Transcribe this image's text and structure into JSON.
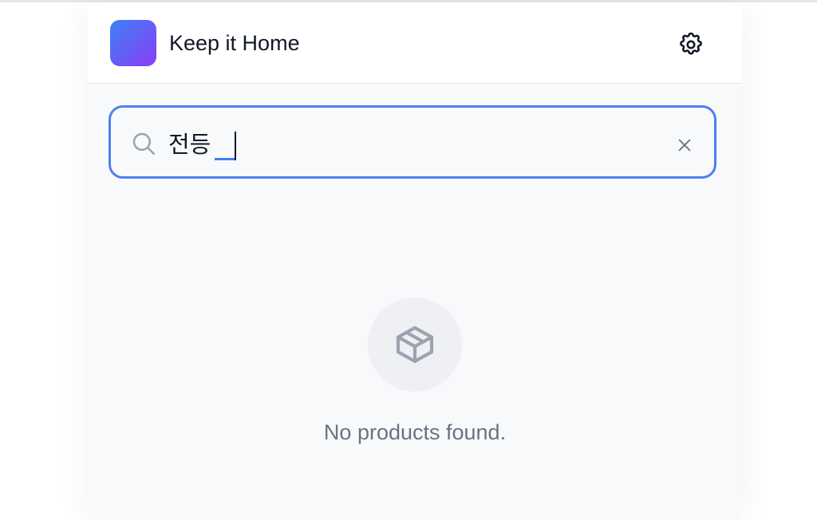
{
  "app": {
    "title": "Keep it Home",
    "brand_gradient": [
      "#3b82f6",
      "#8b3cf6"
    ]
  },
  "header": {
    "settings_icon": "gear-icon"
  },
  "search": {
    "value": "전등",
    "placeholder": "",
    "search_icon": "search-icon",
    "clear_icon": "close-icon",
    "focus_color": "#4f7ff0"
  },
  "empty_state": {
    "icon": "package-icon",
    "message": "No products found."
  }
}
